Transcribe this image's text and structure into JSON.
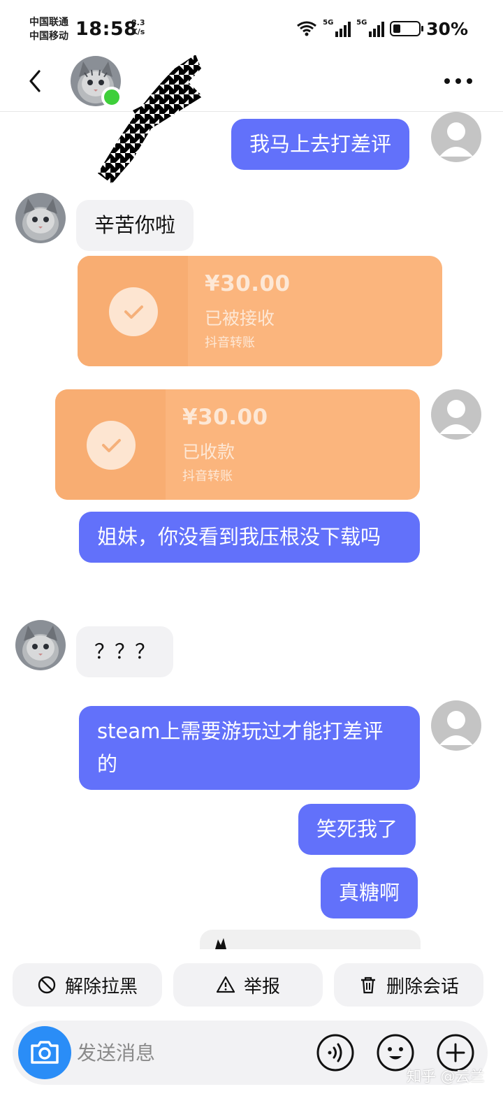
{
  "status_bar": {
    "carrier_1": "中国联通",
    "carrier_2": "中国移动",
    "time": "18:58",
    "net_speed_value": "8.3",
    "net_speed_unit": "K/s",
    "signal_1_label": "5G",
    "signal_2_label": "5G",
    "battery_percent": "30%",
    "battery_level": 0.3
  },
  "header": {
    "back_icon": "chevron-left-icon",
    "more_icon": "more-horizontal-icon",
    "online_color": "#3ecf3a"
  },
  "messages": [
    {
      "sender": "me",
      "text": "我马上去打差评"
    },
    {
      "sender": "other",
      "text": "辛苦你啦"
    },
    {
      "sender": "other",
      "type": "transfer",
      "amount": "¥30.00",
      "status": "已被接收",
      "source": "抖音转账"
    },
    {
      "sender": "me",
      "type": "transfer",
      "amount": "¥30.00",
      "status": "已收款",
      "source": "抖音转账"
    },
    {
      "sender": "me",
      "text": "姐妹，你没看到我压根没下载吗"
    },
    {
      "sender": "other",
      "text": "？？？"
    },
    {
      "sender": "me",
      "text": "steam上需要游玩过才能打差评的"
    },
    {
      "sender": "me",
      "text": "笑死我了"
    },
    {
      "sender": "me",
      "text": "真糖啊"
    }
  ],
  "actions": {
    "unblock_label": "解除拉黑",
    "report_label": "举报",
    "delete_label": "删除会话"
  },
  "input": {
    "placeholder": "发送消息"
  },
  "watermark": "知乎 @云兰",
  "colors": {
    "my_bubble": "#6271fa",
    "other_bubble": "#f2f2f4",
    "transfer_card": "#fbb57d",
    "camera_button": "#2a8df7"
  }
}
